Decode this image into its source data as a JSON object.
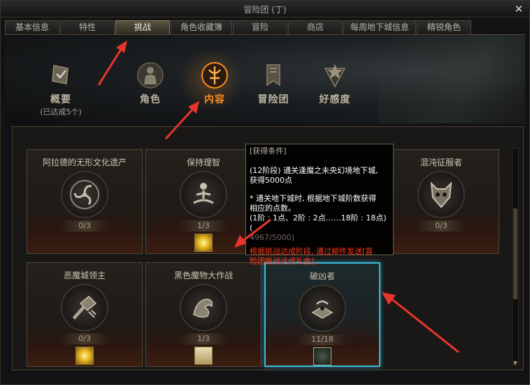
{
  "window": {
    "title": "冒险团 (丁)",
    "close": "✕"
  },
  "tabs": [
    {
      "label": "基本信息",
      "active": false
    },
    {
      "label": "特性",
      "active": false
    },
    {
      "label": "挑战",
      "active": true
    },
    {
      "label": "角色收藏簿",
      "active": false
    },
    {
      "label": "冒险",
      "active": false
    },
    {
      "label": "商店",
      "active": false
    },
    {
      "label": "每周地下城信息",
      "active": false
    },
    {
      "label": "精锐角色",
      "active": false
    }
  ],
  "nav": {
    "overview": {
      "label": "概要",
      "sub": "(已达成5个)",
      "icon": "flag-check-icon"
    },
    "character": {
      "label": "角色",
      "icon": "character-icon"
    },
    "content": {
      "label": "内容",
      "icon": "content-emblem-icon",
      "active": true
    },
    "adventure_team": {
      "label": "冒险团",
      "icon": "banner-icon"
    },
    "favorability": {
      "label": "好感度",
      "icon": "star-emblem-icon"
    }
  },
  "cards": [
    {
      "name": "阿拉德的无形文化遗产",
      "count": "0/3",
      "icon": "triskelion-icon",
      "reward": null,
      "progress": 0
    },
    {
      "name": "保持理智",
      "count": "1/3",
      "icon": "meditation-icon",
      "reward": "gold-reward-icon",
      "progress": 0.33
    },
    {
      "name": "混沌征服者",
      "count": "0/3",
      "icon": "demon-mask-icon",
      "reward": null,
      "progress": 0
    },
    {
      "name": "恶魔城领主",
      "count": "0/3",
      "icon": "broken-weapon-icon",
      "reward": "gold-reward-icon",
      "progress": 0
    },
    {
      "name": "黑色魔物大作战",
      "count": "1/3",
      "icon": "dragon-icon",
      "reward": "scroll-reward-icon",
      "progress": 0.33
    },
    {
      "name": "破凶者",
      "count": "11/18",
      "icon": "altar-icon",
      "reward": "emblem-reward-icon",
      "progress": 0.61,
      "selected": true
    }
  ],
  "tooltip": {
    "header": "[获得条件]",
    "line1": "(12阶段) 通关逢魔之未央幻境地下城,",
    "line2": "获得5000点",
    "line3": "* 通关地下城时, 根据地下城阶数获得",
    "line4": "相应的点数。",
    "line5": "(1阶 : 1点、2阶 : 2点……18阶 : 18点) (",
    "progress": "4967/5000)",
    "warn1": "根据挑战达成阶段, 通过邮件发送[冒",
    "warn2": "险团挑战达成礼盒]。"
  },
  "colors": {
    "accent": "#ff8a1e",
    "selected_border": "#3fb7d6",
    "warn": "#ff3a1a",
    "annotation_arrow": "#e8352b"
  }
}
